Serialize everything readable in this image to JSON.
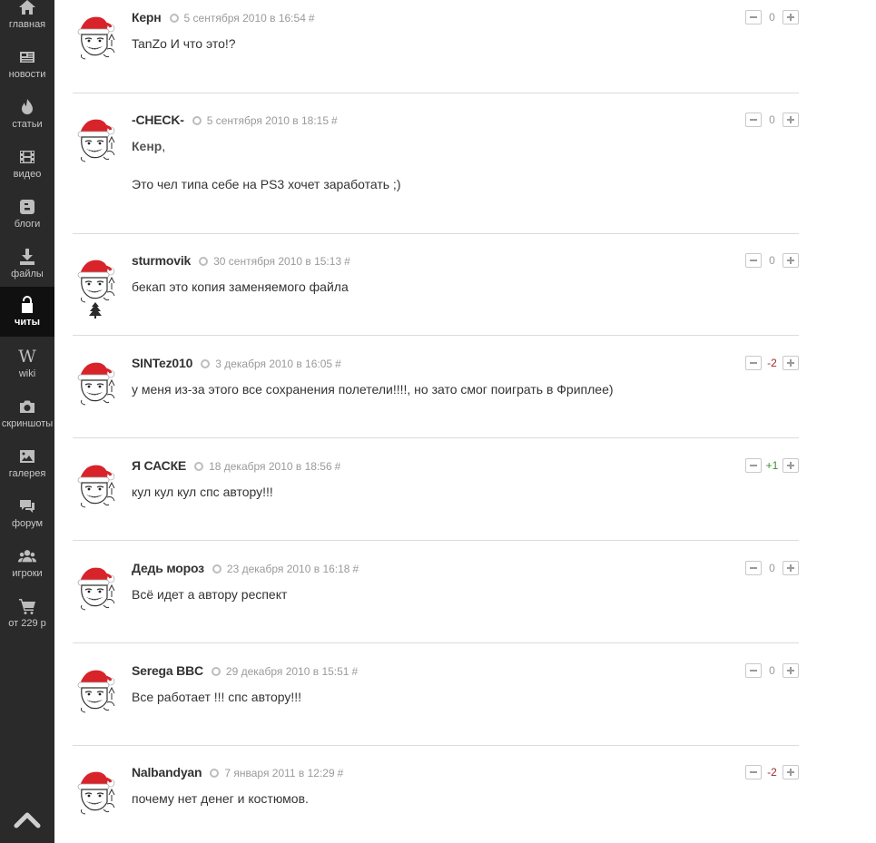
{
  "sidebar": {
    "items": [
      {
        "label": "главная",
        "icon": "home-icon"
      },
      {
        "label": "новости",
        "icon": "news-icon"
      },
      {
        "label": "статьи",
        "icon": "fire-icon"
      },
      {
        "label": "видео",
        "icon": "film-icon"
      },
      {
        "label": "блоги",
        "icon": "blogger-icon"
      },
      {
        "label": "файлы",
        "icon": "download-icon"
      },
      {
        "label": "читы",
        "icon": "unlock-icon",
        "active": true
      },
      {
        "label": "wiki",
        "icon": "wikipedia-icon"
      },
      {
        "label": "скриншоты",
        "icon": "camera-icon"
      },
      {
        "label": "галерея",
        "icon": "picture-icon"
      },
      {
        "label": "форум",
        "icon": "chat-icon"
      },
      {
        "label": "игроки",
        "icon": "users-icon"
      },
      {
        "label": "от 229 р",
        "icon": "cart-icon"
      }
    ],
    "scroll_top_icon": "chevron-up-icon"
  },
  "colors": {
    "sidebar_bg": "#2a2a2a",
    "sidebar_active_bg": "#101010",
    "negative_score": "#a32b2b",
    "positive_score": "#3c8f2f"
  },
  "comments": [
    {
      "author": "Керн",
      "date": "5 сентября 2010 в 16:54",
      "hash": "#",
      "score": "0",
      "lines": [
        "TanZo И что это!?"
      ]
    },
    {
      "author": "-CHECK-",
      "date": "5 сентября 2010 в 18:15",
      "hash": "#",
      "score": "0",
      "mention": "Кенр",
      "mention_suffix": ",",
      "lines": [
        "Это чел типа себе на PS3 хочет заработать ;)"
      ]
    },
    {
      "author": "sturmovik",
      "date": "30 сентября 2010 в 15:13",
      "hash": "#",
      "score": "0",
      "lines": [
        "бекап это копия заменяемого файла"
      ]
    },
    {
      "author": "SINTez010",
      "date": "3 декабря 2010 в 16:05",
      "hash": "#",
      "score": "-2",
      "lines": [
        "у меня из-за этого все сохранения полетели!!!!, но зато смог поиграть в Фриплее)"
      ]
    },
    {
      "author": "Я САСКЕ",
      "date": "18 декабря 2010 в 18:56",
      "hash": "#",
      "score": "+1",
      "lines": [
        "кул кул кул спс автору!!!"
      ]
    },
    {
      "author": "Дедь мороз",
      "date": "23 декабря 2010 в 16:18",
      "hash": "#",
      "score": "0",
      "lines": [
        "Всё идет а автору респект"
      ]
    },
    {
      "author": "Serega BBC",
      "date": "29 декабря 2010 в 15:51",
      "hash": "#",
      "score": "0",
      "lines": [
        "Все работает !!! спс автору!!!"
      ]
    },
    {
      "author": "Nalbandyan",
      "date": "7 января 2011 в 12:29",
      "hash": "#",
      "score": "-2",
      "lines": [
        "почему нет денег и костюмов."
      ]
    }
  ]
}
